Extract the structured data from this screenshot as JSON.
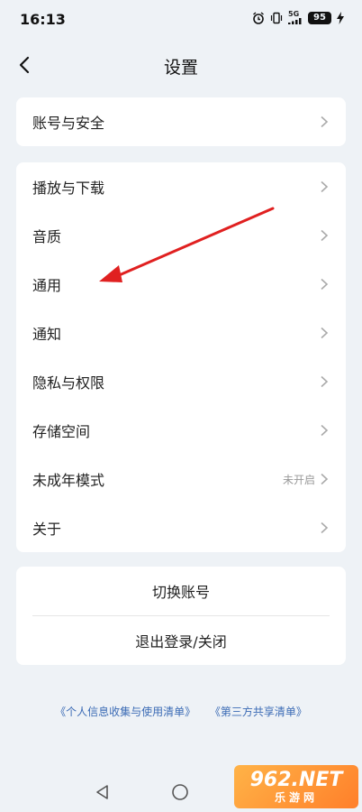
{
  "status": {
    "time": "16:13",
    "network": "5G",
    "battery": "95"
  },
  "header": {
    "title": "设置"
  },
  "groups": {
    "account": [
      {
        "label": "账号与安全",
        "value": ""
      }
    ],
    "main": [
      {
        "label": "播放与下载",
        "value": ""
      },
      {
        "label": "音质",
        "value": ""
      },
      {
        "label": "通用",
        "value": ""
      },
      {
        "label": "通知",
        "value": ""
      },
      {
        "label": "隐私与权限",
        "value": ""
      },
      {
        "label": "存储空间",
        "value": ""
      },
      {
        "label": "未成年模式",
        "value": "未开启"
      },
      {
        "label": "关于",
        "value": ""
      }
    ]
  },
  "actions": {
    "switch_account": "切换账号",
    "logout": "退出登录/关闭"
  },
  "footer_links": {
    "personal_info": "《个人信息收集与使用清单》",
    "third_party": "《第三方共享清单》"
  },
  "watermark": {
    "top": "962.NET",
    "bottom": "乐游网"
  },
  "colors": {
    "background": "#eef2f6",
    "card": "#ffffff",
    "link": "#3b6bb5",
    "annotation_arrow": "#e02020"
  }
}
